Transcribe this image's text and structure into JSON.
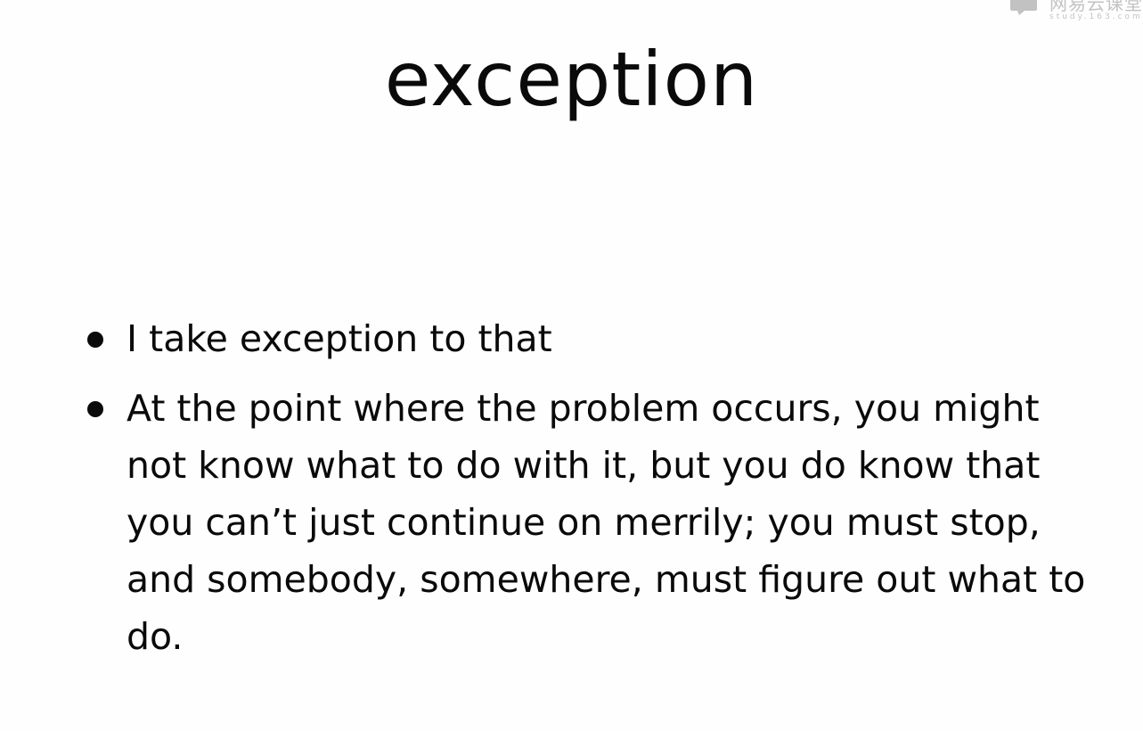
{
  "slide": {
    "title": "exception",
    "bullets": [
      {
        "text": "I take exception to that"
      },
      {
        "text": "At the point where the problem occurs, you might not know what to do with it, but you do know that you can’t just continue on merrily; you must stop, and somebody, somewhere, must figure out what to do."
      }
    ]
  },
  "watermark": {
    "text_cn": "网易云课堂",
    "url": "study.163.com",
    "icon": "study-logo-icon"
  }
}
